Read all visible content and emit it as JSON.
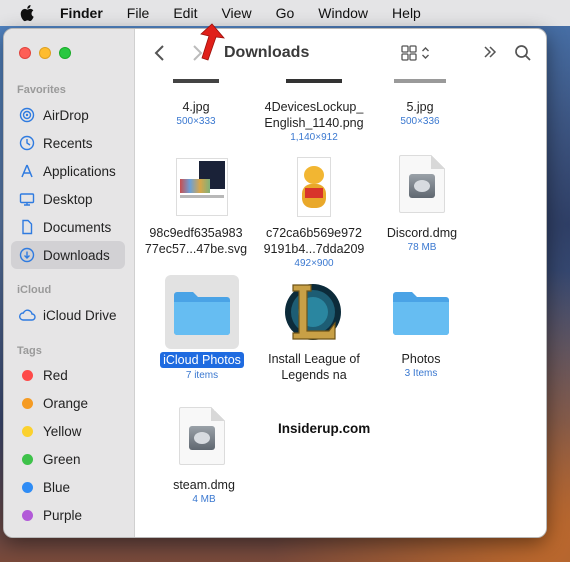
{
  "menubar": {
    "items": [
      "Finder",
      "File",
      "Edit",
      "View",
      "Go",
      "Window",
      "Help"
    ]
  },
  "toolbar": {
    "title": "Downloads"
  },
  "sidebar": {
    "favorites_header": "Favorites",
    "favorites": [
      {
        "label": "AirDrop",
        "icon": "airdrop-icon"
      },
      {
        "label": "Recents",
        "icon": "clock-icon"
      },
      {
        "label": "Applications",
        "icon": "applications-icon"
      },
      {
        "label": "Desktop",
        "icon": "desktop-icon"
      },
      {
        "label": "Documents",
        "icon": "document-icon"
      },
      {
        "label": "Downloads",
        "icon": "download-icon",
        "active": true
      }
    ],
    "icloud_header": "iCloud",
    "icloud": [
      {
        "label": "iCloud Drive",
        "icon": "cloud-icon"
      }
    ],
    "tags_header": "Tags",
    "tags": [
      {
        "label": "Red",
        "color": "#fe4a49"
      },
      {
        "label": "Orange",
        "color": "#f59b23"
      },
      {
        "label": "Yellow",
        "color": "#fbd12e"
      },
      {
        "label": "Green",
        "color": "#3ec24a"
      },
      {
        "label": "Blue",
        "color": "#2f8cf5"
      },
      {
        "label": "Purple",
        "color": "#b25ad8"
      }
    ]
  },
  "files": [
    {
      "name": "4.jpg",
      "meta": "500×333"
    },
    {
      "name": "4DevicesLockup_\nEnglish_1140.png",
      "meta": "1,140×912"
    },
    {
      "name": "5.jpg",
      "meta": "500×336"
    },
    {
      "name": "98c9edf635a983\n77ec57...47be.svg",
      "meta": ""
    },
    {
      "name": "c72ca6b569e972\n9191b4...7dda209",
      "meta": "492×900"
    },
    {
      "name": "Discord.dmg",
      "meta": "78 MB"
    },
    {
      "name": "iCloud Photos",
      "meta": "7 items",
      "selected": true
    },
    {
      "name": "Install League of\nLegends na",
      "meta": ""
    },
    {
      "name": "Photos",
      "meta": "3 Items"
    },
    {
      "name": "steam.dmg",
      "meta": "4 MB"
    }
  ],
  "watermark": "Insiderup.com",
  "colors": {
    "accent": "#1f6be0",
    "meta_blue": "#3a78d0",
    "folder": "#5fb6ef",
    "annotation_arrow": "#e0201a"
  }
}
